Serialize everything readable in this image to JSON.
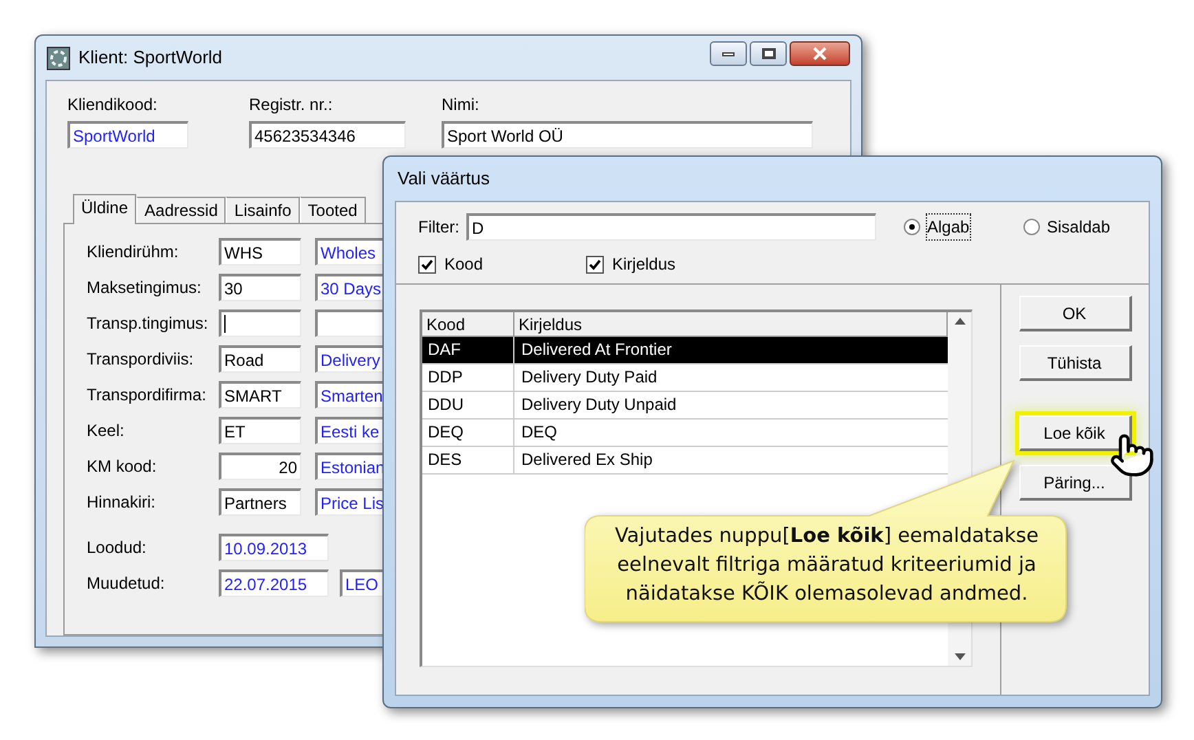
{
  "client_window": {
    "title": "Klient: SportWorld",
    "header_fields": [
      {
        "label": "Kliendikood:",
        "value": "SportWorld",
        "kind": "lookup"
      },
      {
        "label": "Registr. nr.:",
        "value": "45623534346",
        "kind": "input"
      },
      {
        "label": "Nimi:",
        "value": "Sport World OÜ",
        "kind": "input"
      }
    ],
    "tabs": [
      {
        "label": "Üldine",
        "selected": true
      },
      {
        "label": "Aadressid",
        "selected": false
      },
      {
        "label": "Lisainfo",
        "selected": false
      },
      {
        "label": "Tooted",
        "selected": false
      }
    ],
    "rows": [
      {
        "label": "Kliendirühm:",
        "code": "WHS",
        "description": "Wholes",
        "numeric": false,
        "focused": false
      },
      {
        "label": "Maksetingimus:",
        "code": "30",
        "description": "30 Days",
        "numeric": false,
        "focused": false
      },
      {
        "label": "Transp.tingimus:",
        "numeric": false,
        "focused": true
      },
      {
        "label": "Transpordiviis:",
        "code": "Road",
        "description": "Delivery",
        "numeric": false,
        "focused": false
      },
      {
        "label": "Transpordifirma:",
        "code": "SMART",
        "description": "Smarten",
        "numeric": false,
        "focused": false
      },
      {
        "label": "Keel:",
        "code": "ET",
        "description": "Eesti ke",
        "numeric": false,
        "focused": false
      },
      {
        "label": "KM kood:",
        "code": "20",
        "description": "Estonian",
        "numeric": true,
        "focused": false
      },
      {
        "label": "Hinnakiri:",
        "code": "Partners",
        "description": "Price Lis",
        "numeric": false,
        "focused": false
      }
    ],
    "dates": [
      {
        "label": "Loodud:",
        "date": "10.09.2013"
      },
      {
        "label": "Muudetud:",
        "date": "22.07.2015",
        "user": "LEO"
      }
    ]
  },
  "dialog": {
    "title": "Vali väärtus",
    "filter": {
      "label": "Filter:",
      "value": "D"
    },
    "match_options": [
      {
        "label": "Algab",
        "selected": true
      },
      {
        "label": "Sisaldab",
        "selected": false
      }
    ],
    "search_in": [
      {
        "label": "Kood",
        "checked": true
      },
      {
        "label": "Kirjeldus",
        "checked": true
      }
    ],
    "table": {
      "columns": [
        "Kood",
        "Kirjeldus"
      ],
      "rows": [
        {
          "code": "DAF",
          "description": "Delivered At Frontier",
          "selected": true
        },
        {
          "code": "DDP",
          "description": "Delivery Duty Paid",
          "selected": false
        },
        {
          "code": "DDU",
          "description": "Delivery Duty Unpaid",
          "selected": false
        },
        {
          "code": "DEQ",
          "description": "DEQ",
          "selected": false
        },
        {
          "code": "DES",
          "description": "Delivered Ex Ship",
          "selected": false
        }
      ]
    },
    "buttons": [
      {
        "label": "OK",
        "highlighted": false
      },
      {
        "label": "Tühista",
        "highlighted": false
      },
      {
        "label": "Loe kõik",
        "highlighted": true
      },
      {
        "label": "Päring...",
        "highlighted": false
      }
    ]
  },
  "callout": {
    "text": "Vajutades nuppu[**Loe kõik**] eemaldatakse eelnevalt filtriga määratud kriteeriumid ja näidatakse KÕIK olemasolevad andmed."
  }
}
